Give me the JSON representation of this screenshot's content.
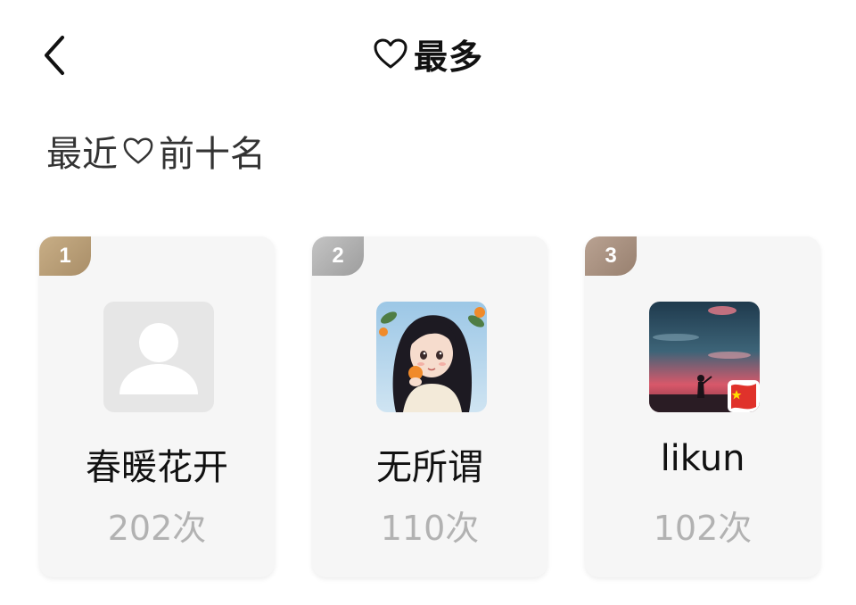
{
  "header": {
    "title": "最多",
    "back_icon": "chevron-left-icon",
    "title_icon": "heart-outline-icon"
  },
  "section": {
    "title_part1": "最近",
    "title_part2": "前十名",
    "icon": "heart-outline-icon"
  },
  "ranking": [
    {
      "rank": "1",
      "name": "春暖花开",
      "count": "202次",
      "avatar": "default-avatar-icon",
      "badge_color": "#b89d74"
    },
    {
      "rank": "2",
      "name": "无所谓",
      "count": "110次",
      "avatar": "anime-girl-avatar",
      "badge_color": "#adadad"
    },
    {
      "rank": "3",
      "name": "likun",
      "count": "102次",
      "avatar": "sunset-silhouette-avatar",
      "badge_color": "#a8907f"
    }
  ]
}
